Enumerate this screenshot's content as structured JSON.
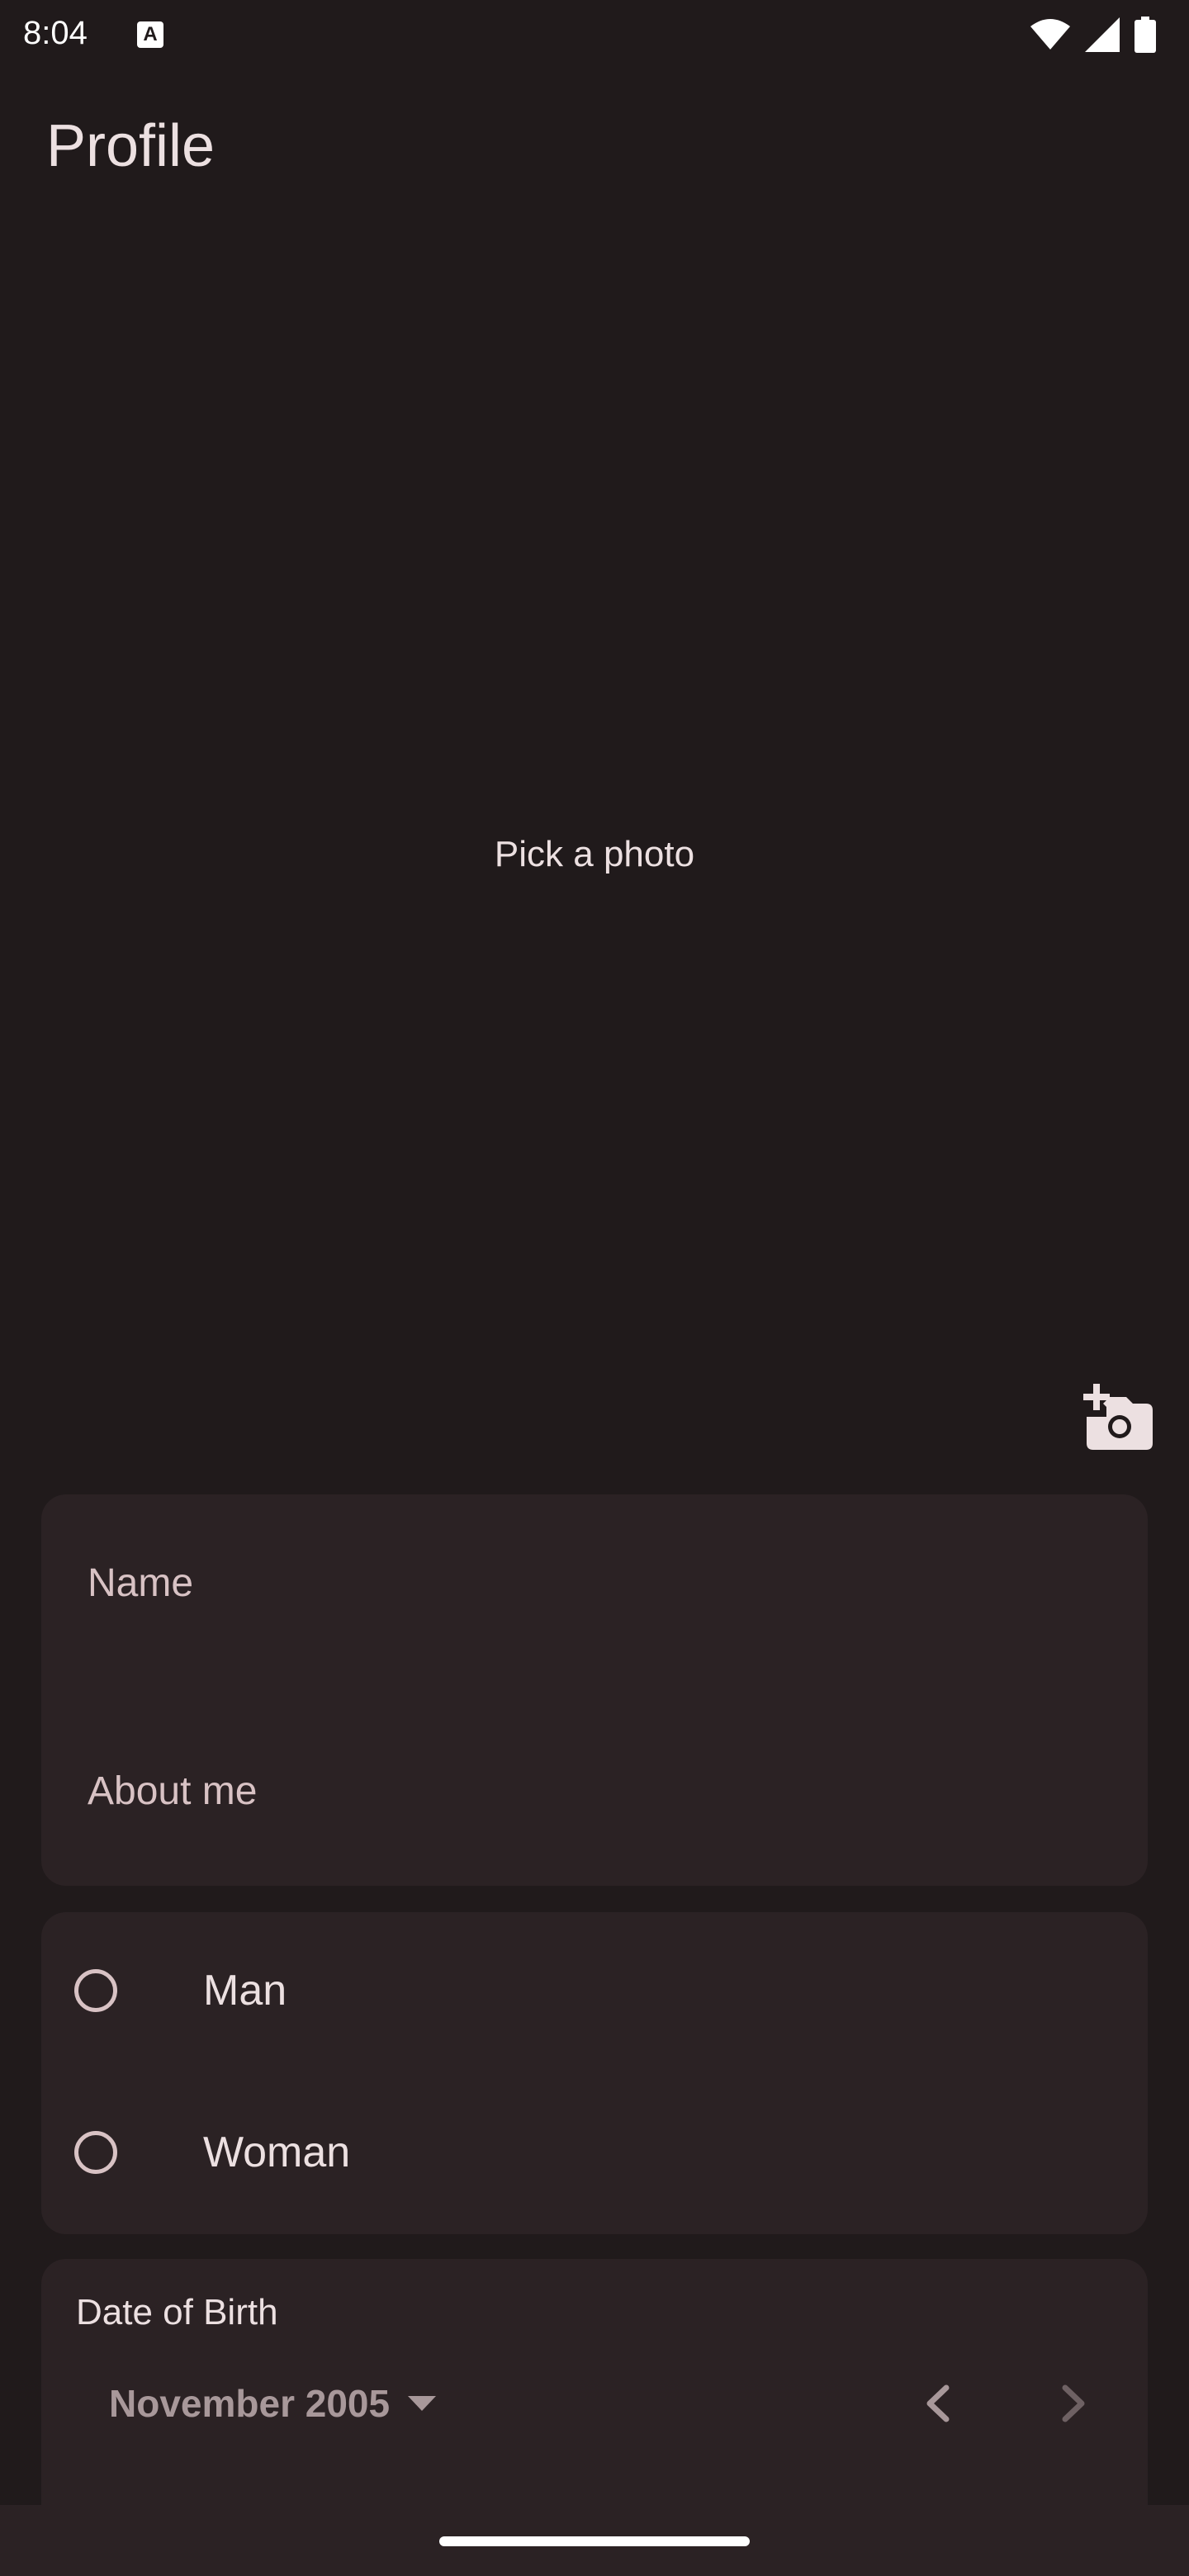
{
  "status_bar": {
    "time": "8:04",
    "app_icon_letter": "A",
    "icons": [
      "wifi-icon",
      "cellular-signal-icon",
      "battery-icon"
    ]
  },
  "page": {
    "title": "Profile"
  },
  "photo": {
    "prompt": "Pick a photo",
    "add_photo_icon": "add-a-photo-icon"
  },
  "form": {
    "name_label": "Name",
    "about_label": "About me"
  },
  "gender": {
    "options": [
      {
        "label": "Man",
        "selected": false
      },
      {
        "label": "Woman",
        "selected": false
      }
    ]
  },
  "dob": {
    "title": "Date of Birth",
    "month_year": "November 2005"
  },
  "colors": {
    "background": "#201a1b",
    "card": "#2b2224",
    "text": "#ece0e1",
    "muted": "#d8c2c4"
  }
}
